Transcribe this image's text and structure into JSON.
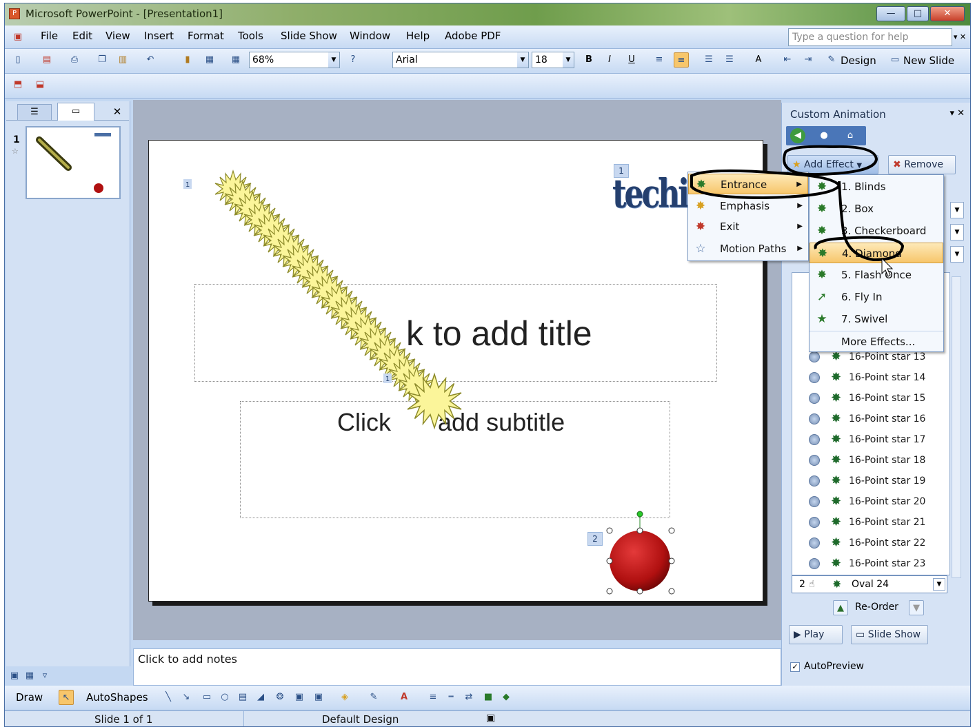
{
  "window": {
    "title": "Microsoft PowerPoint - [Presentation1]",
    "minimize": "—",
    "restore": "□",
    "close": "✕"
  },
  "menubar": {
    "items": [
      "File",
      "Edit",
      "View",
      "Insert",
      "Format",
      "Tools",
      "Slide Show",
      "Window",
      "Help",
      "Adobe PDF"
    ],
    "help_placeholder": "Type a question for help"
  },
  "toolbar": {
    "zoom": "68%",
    "font": "Arial",
    "size": "18",
    "bold": "B",
    "italic": "I",
    "underline": "U",
    "design": "Design",
    "new_slide": "New Slide"
  },
  "left_pane": {
    "slide_number": "1"
  },
  "slide": {
    "title_placeholder": "Click to add title",
    "title_visible_fragment": "k to add title",
    "subtitle_placeholder": "Click to add subtitle",
    "subtitle_left": "Click",
    "subtitle_right": "add subtitle",
    "logo_text": "techitu",
    "tag_logo": "1",
    "tag_stars": "1",
    "tag_oval": "2",
    "star_tag": "1"
  },
  "notes": {
    "placeholder": "Click to add notes"
  },
  "task_pane": {
    "title": "Custom Animation",
    "add_effect": "Add Effect",
    "remove": "Remove",
    "list_items": [
      "16-Point star 13",
      "16-Point star 14",
      "16-Point star 15",
      "16-Point star 16",
      "16-Point star 17",
      "16-Point star 18",
      "16-Point star 19",
      "16-Point star 20",
      "16-Point star 21",
      "16-Point star 22",
      "16-Point star 23"
    ],
    "oval_row": {
      "num": "2",
      "label": "Oval 24"
    },
    "reorder": "Re-Order",
    "play": "Play",
    "slide_show": "Slide Show",
    "autopreview": "AutoPreview"
  },
  "effect_menu": {
    "items": [
      "Entrance",
      "Emphasis",
      "Exit",
      "Motion Paths"
    ],
    "submenu": [
      "1. Blinds",
      "2. Box",
      "3. Checkerboard",
      "4. Diamond",
      "5. Flash Once",
      "6. Fly In",
      "7. Swivel"
    ],
    "more": "More Effects..."
  },
  "drawing_toolbar": {
    "draw": "Draw",
    "autoshapes": "AutoShapes"
  },
  "status": {
    "slide": "Slide 1 of 1",
    "design": "Default Design"
  },
  "colors": {
    "accent": "#4a6fa5",
    "star_fill": "#fbf59a",
    "oval": "#b01010",
    "highlight": "#f7c66b"
  }
}
